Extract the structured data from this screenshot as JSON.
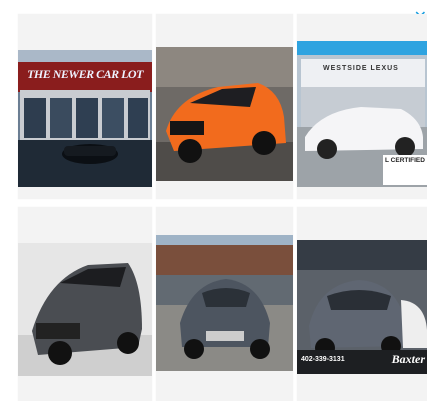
{
  "adchoices": {
    "icon": "adchoices-icon",
    "close_icon": "close-icon"
  },
  "cards": [
    {
      "id": "card-1",
      "sign": "THE NEWER CAR LOT"
    },
    {
      "id": "card-2",
      "sign": ""
    },
    {
      "id": "card-3",
      "sign": "WESTSIDE LEXUS",
      "badge": "L CERTIFIED"
    },
    {
      "id": "card-4",
      "sign": ""
    },
    {
      "id": "card-5",
      "sign": ""
    },
    {
      "id": "card-6",
      "phone": "402-339-3131",
      "dealer": "Baxter"
    }
  ]
}
